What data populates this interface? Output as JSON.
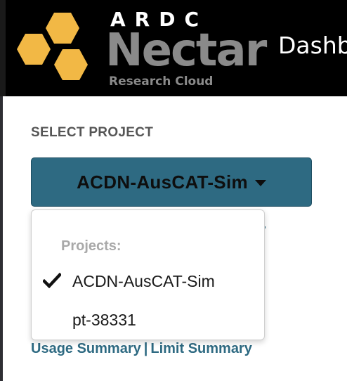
{
  "header": {
    "ardc_text": "ARDC",
    "brand_name": "Nectar",
    "brand_subtitle": "Research Cloud",
    "page_title": "Dashboard"
  },
  "sidebar": {
    "select_project_label": "SELECT PROJECT",
    "current_project": "ACDN-AusCAT-Sim",
    "links": {
      "usage_summary": "Usage Summary",
      "separator": "|",
      "limit_summary": "Limit Summary"
    }
  },
  "dropdown": {
    "header": "Projects:",
    "items": [
      {
        "label": "ACDN-AusCAT-Sim",
        "selected": true
      },
      {
        "label": "pt-38331",
        "selected": false
      }
    ]
  },
  "colors": {
    "accent": "#2e6a82",
    "header_bg": "#000000",
    "hex_gold": "#f2b845",
    "brand_grey": "#8a8a8a"
  }
}
